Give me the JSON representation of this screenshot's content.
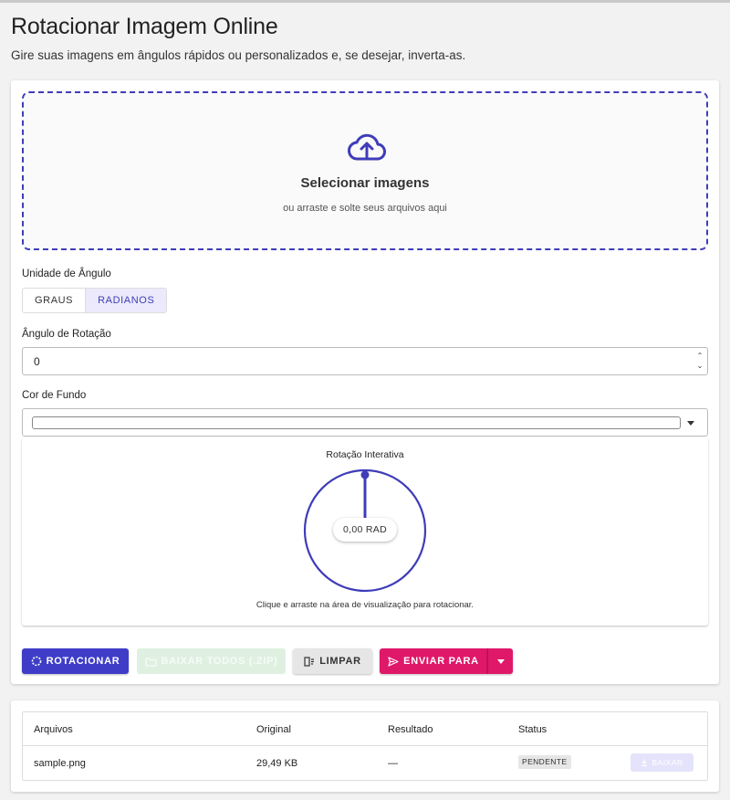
{
  "header": {
    "title": "Rotacionar Imagem Online",
    "subtitle": "Gire suas imagens em ângulos rápidos ou personalizados e, se desejar, inverta-as."
  },
  "upload": {
    "icon": "cloud-upload-icon",
    "title": "Selecionar imagens",
    "subtitle": "ou arraste e solte seus arquivos aqui"
  },
  "angle_unit": {
    "label": "Unidade de Ângulo",
    "options": [
      "GRAUS",
      "RADIANOS"
    ],
    "selected": "RADIANOS"
  },
  "rotation_angle": {
    "label": "Ângulo de Rotação",
    "value": "0"
  },
  "background_color": {
    "label": "Cor de Fundo",
    "value": "#ffffff"
  },
  "preview": {
    "title": "Rotação Interativa",
    "angle_display": "0,00 RAD",
    "angle_value": 0,
    "hint": "Clique e arraste na área de visualização para rotacionar."
  },
  "actions": {
    "rotate": "ROTACIONAR",
    "download_all": "BAIXAR TODOS (.ZIP)",
    "clear": "LIMPAR",
    "send_to": "ENVIAR PARA"
  },
  "files_table": {
    "columns": [
      "Arquivos",
      "Original",
      "Resultado",
      "Status"
    ],
    "rows": [
      {
        "name": "sample.png",
        "original": "29,49 KB",
        "result": "—",
        "status": "PENDENTE",
        "action": "BAIXAR"
      }
    ]
  },
  "colors": {
    "primary": "#3f3dc8",
    "accent": "#e0186a",
    "background": "#f2f2f2"
  }
}
